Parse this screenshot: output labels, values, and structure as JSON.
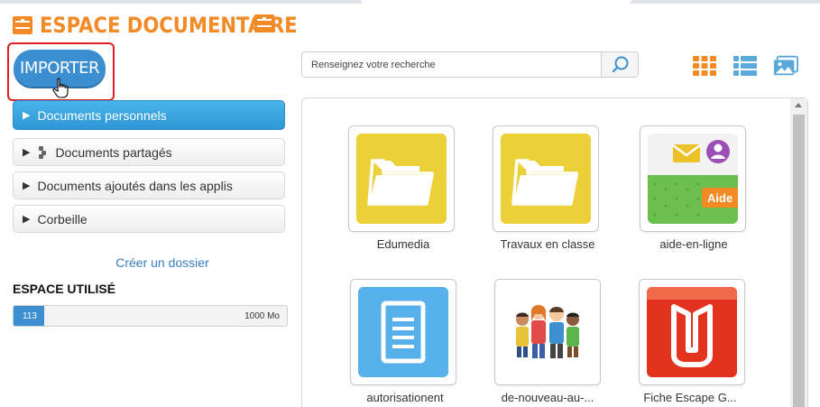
{
  "header": {
    "title": "ESPACE DOCUMENTAIRE",
    "accent_color": "#f28a25"
  },
  "import_button": {
    "label": "IMPORTER",
    "color": "#3b8fd1",
    "highlight_color": "#e02020"
  },
  "sidebar": {
    "items": [
      {
        "label": "Documents personnels",
        "active": true,
        "icon": "triangle-right-icon"
      },
      {
        "label": "Documents partagés",
        "active": false,
        "icon": "share-icon"
      },
      {
        "label": "Documents ajoutés dans les applis",
        "active": false,
        "icon": "triangle-right-icon"
      },
      {
        "label": "Corbeille",
        "active": false,
        "icon": "triangle-right-icon"
      }
    ],
    "create_folder": "Créer un dossier",
    "space_label": "ESPACE UTILISÉ",
    "space_used": "113",
    "space_total": "1000 Mo",
    "space_fraction": 0.113
  },
  "search": {
    "placeholder": "Renseignez votre recherche",
    "value": ""
  },
  "view_modes": [
    "grid-view-icon",
    "list-view-icon",
    "gallery-view-icon"
  ],
  "files": [
    {
      "name": "Edumedia",
      "type": "folder"
    },
    {
      "name": "Travaux en classe",
      "type": "folder"
    },
    {
      "name": "aide-en-ligne",
      "type": "image"
    },
    {
      "name": "autorisationent",
      "type": "document"
    },
    {
      "name": "de-nouveau-au-...",
      "type": "image"
    },
    {
      "name": "Fiche Escape G...",
      "type": "pdf"
    }
  ]
}
